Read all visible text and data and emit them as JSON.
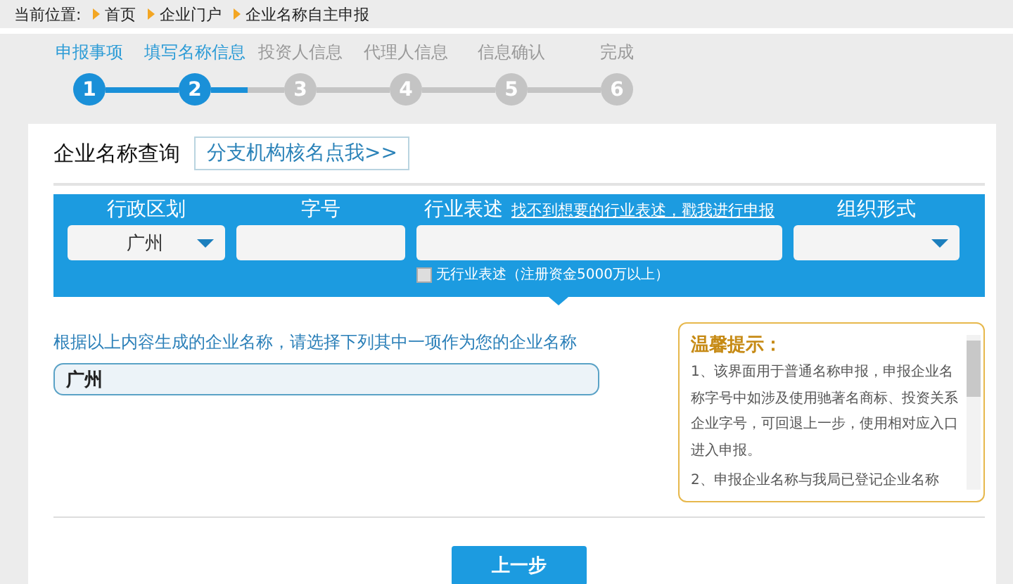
{
  "breadcrumb": {
    "label": "当前位置:",
    "items": [
      "首页",
      "企业门户",
      "企业名称自主申报"
    ]
  },
  "steps": [
    {
      "number": "1",
      "label": "申报事项",
      "active": true
    },
    {
      "number": "2",
      "label": "填写名称信息",
      "active": true
    },
    {
      "number": "3",
      "label": "投资人信息",
      "active": false
    },
    {
      "number": "4",
      "label": "代理人信息",
      "active": false
    },
    {
      "number": "5",
      "label": "信息确认",
      "active": false
    },
    {
      "number": "6",
      "label": "完成",
      "active": false
    }
  ],
  "query": {
    "title": "企业名称查询",
    "branch_link": "分支机构核名点我>>"
  },
  "search_bar": {
    "fields": [
      {
        "kind": "select",
        "label": "行政区划",
        "value": "广州"
      },
      {
        "kind": "text",
        "label": "字号"
      },
      {
        "kind": "text",
        "label": "行业表述",
        "link": "找不到想要的行业表述，戳我进行申报"
      },
      {
        "kind": "select",
        "label": "组织形式"
      }
    ],
    "checkbox": {
      "label": "无行业表述（注册资金5000万以上）",
      "checked": false
    }
  },
  "instruction": "根据以上内容生成的企业名称，请选择下列其中一项作为您的企业名称",
  "name_option": {
    "value": "广州"
  },
  "tips": {
    "title": "温馨提示：",
    "paragraphs": [
      "1、该界面用于普通名称申报，申报企业名称字号中如涉及使用驰著名商标、投资关系企业字号，可回退上一步，使用相对应入口进入申报。",
      "2、申报企业名称与我局已登记企业名称"
    ]
  },
  "buttons": [
    {
      "label": "上一步"
    }
  ]
}
